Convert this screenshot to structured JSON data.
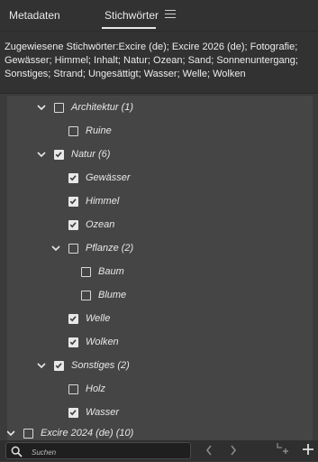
{
  "tabs": {
    "metadata": "Metadaten",
    "keywords": "Stichwörter"
  },
  "assigned_keywords": "Zugewiesene Stichwörter:Excire (de); Excire 2026 (de); Fotografie; Gewässer; Himmel; Inhalt; Natur; Ozean; Sand; Sonnenuntergang; Sonstiges; Strand; Ungesättigt; Wasser; Welle; Wolken",
  "tree": {
    "rows": [
      {
        "label": "Architektur (1)",
        "expander": "chevron-down-icon",
        "checked": false
      },
      {
        "label": "Ruine",
        "checked": false
      },
      {
        "label": "Natur (6)",
        "expander": "chevron-down-icon",
        "checked": true
      },
      {
        "label": "Gewässer",
        "checked": true
      },
      {
        "label": "Himmel",
        "checked": true
      },
      {
        "label": "Ozean",
        "checked": true
      },
      {
        "label": "Pflanze (2)",
        "expander": "chevron-down-icon",
        "checked": false
      },
      {
        "label": "Baum",
        "checked": false
      },
      {
        "label": "Blume",
        "checked": false
      },
      {
        "label": "Welle",
        "checked": true
      },
      {
        "label": "Wolken",
        "checked": true
      },
      {
        "label": "Sonstiges (2)",
        "expander": "chevron-down-icon",
        "checked": true
      },
      {
        "label": "Holz",
        "checked": false
      },
      {
        "label": "Wasser",
        "checked": true
      }
    ],
    "partial_row": {
      "label": "Excire 2024 (de) (10)",
      "expander": "chevron-down-icon",
      "checked": false
    }
  },
  "footer": {
    "search_placeholder": "Suchen",
    "icons": [
      "search-icon",
      "previous-icon",
      "next-icon",
      "add-sub-keyword-icon",
      "add-keyword-icon"
    ]
  },
  "colors": {
    "panel": "#3b3b3b",
    "header": "#323232",
    "tree_bg": "#454545",
    "footer": "#2f2f2f",
    "text": "#e8e8e8"
  }
}
